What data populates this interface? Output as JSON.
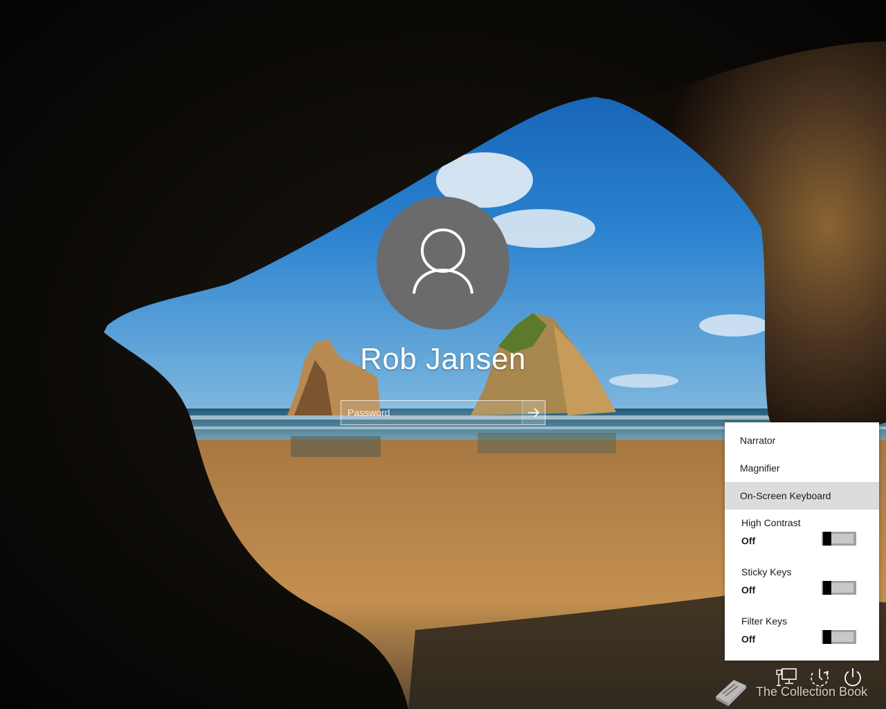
{
  "user": {
    "name": "Rob Jansen"
  },
  "password": {
    "placeholder": "Password"
  },
  "ease_of_access": {
    "items": [
      {
        "label": "Narrator"
      },
      {
        "label": "Magnifier"
      },
      {
        "label": "On-Screen Keyboard"
      }
    ],
    "toggles": [
      {
        "label": "High Contrast",
        "state": "Off"
      },
      {
        "label": "Sticky Keys",
        "state": "Off"
      },
      {
        "label": "Filter Keys",
        "state": "Off"
      }
    ]
  },
  "icons": {
    "network": "network-icon",
    "ease_of_access": "ease-of-access-icon",
    "power": "power-icon",
    "submit": "arrow-right-icon",
    "user": "user-icon",
    "watermark": "book-icon"
  },
  "watermark": {
    "text": "The Collection Book"
  }
}
